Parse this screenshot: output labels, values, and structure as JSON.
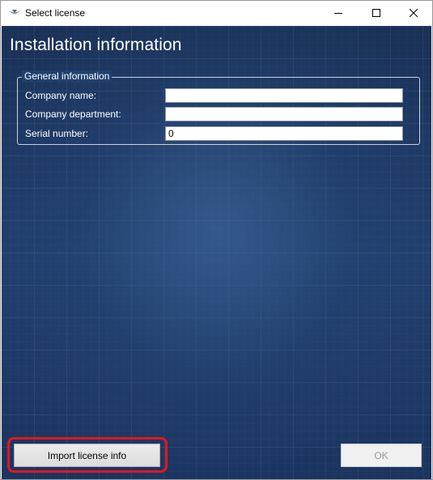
{
  "window": {
    "title": "Select license"
  },
  "page": {
    "heading": "Installation information"
  },
  "general_info": {
    "legend": "General information",
    "fields": [
      {
        "label": "Company name:",
        "value": ""
      },
      {
        "label": "Company department:",
        "value": ""
      },
      {
        "label": "Serial number:",
        "value": "0"
      }
    ]
  },
  "buttons": {
    "import_label": "Import license info",
    "ok_label": "OK",
    "ok_enabled": false
  },
  "colors": {
    "background_blue": "#1e3a66",
    "highlight_red": "#e8151b"
  }
}
